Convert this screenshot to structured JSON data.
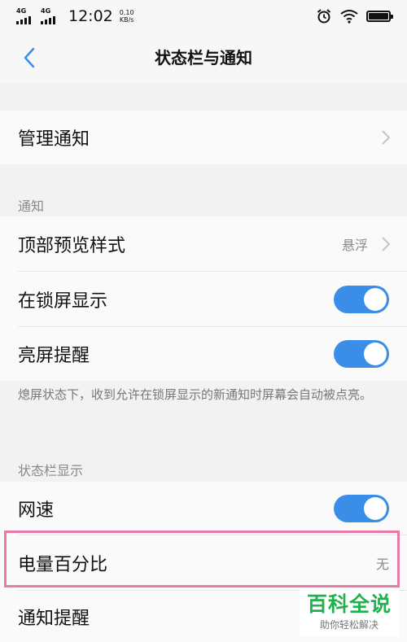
{
  "status_bar": {
    "network1": "4G",
    "network2": "4G",
    "time": "12:02",
    "speed_value": "0.10",
    "speed_unit": "KB/s",
    "icons": [
      "alarm-icon",
      "wifi-icon",
      "battery-icon"
    ]
  },
  "header": {
    "back_icon": "chevron-left-icon",
    "title": "状态栏与通知"
  },
  "manage": {
    "label": "管理通知"
  },
  "notification_section": {
    "label": "通知",
    "items": [
      {
        "label": "顶部预览样式",
        "value": "悬浮"
      },
      {
        "label": "在锁屏显示",
        "toggle": true
      },
      {
        "label": "亮屏提醒",
        "toggle": true
      }
    ],
    "note": "熄屏状态下，收到允许在锁屏显示的新通知时屏幕会自动被点亮。"
  },
  "statusbar_section": {
    "label": "状态栏显示",
    "items": [
      {
        "label": "网速",
        "toggle": true
      },
      {
        "label": "电量百分比",
        "value": "无"
      },
      {
        "label": "通知提醒"
      }
    ]
  },
  "watermark": {
    "title": "百科全说",
    "subtitle": "助你轻松解决"
  },
  "colors": {
    "accent": "#3a8ee8",
    "highlight": "#e87aa8",
    "watermark_green": "#22b14c"
  }
}
